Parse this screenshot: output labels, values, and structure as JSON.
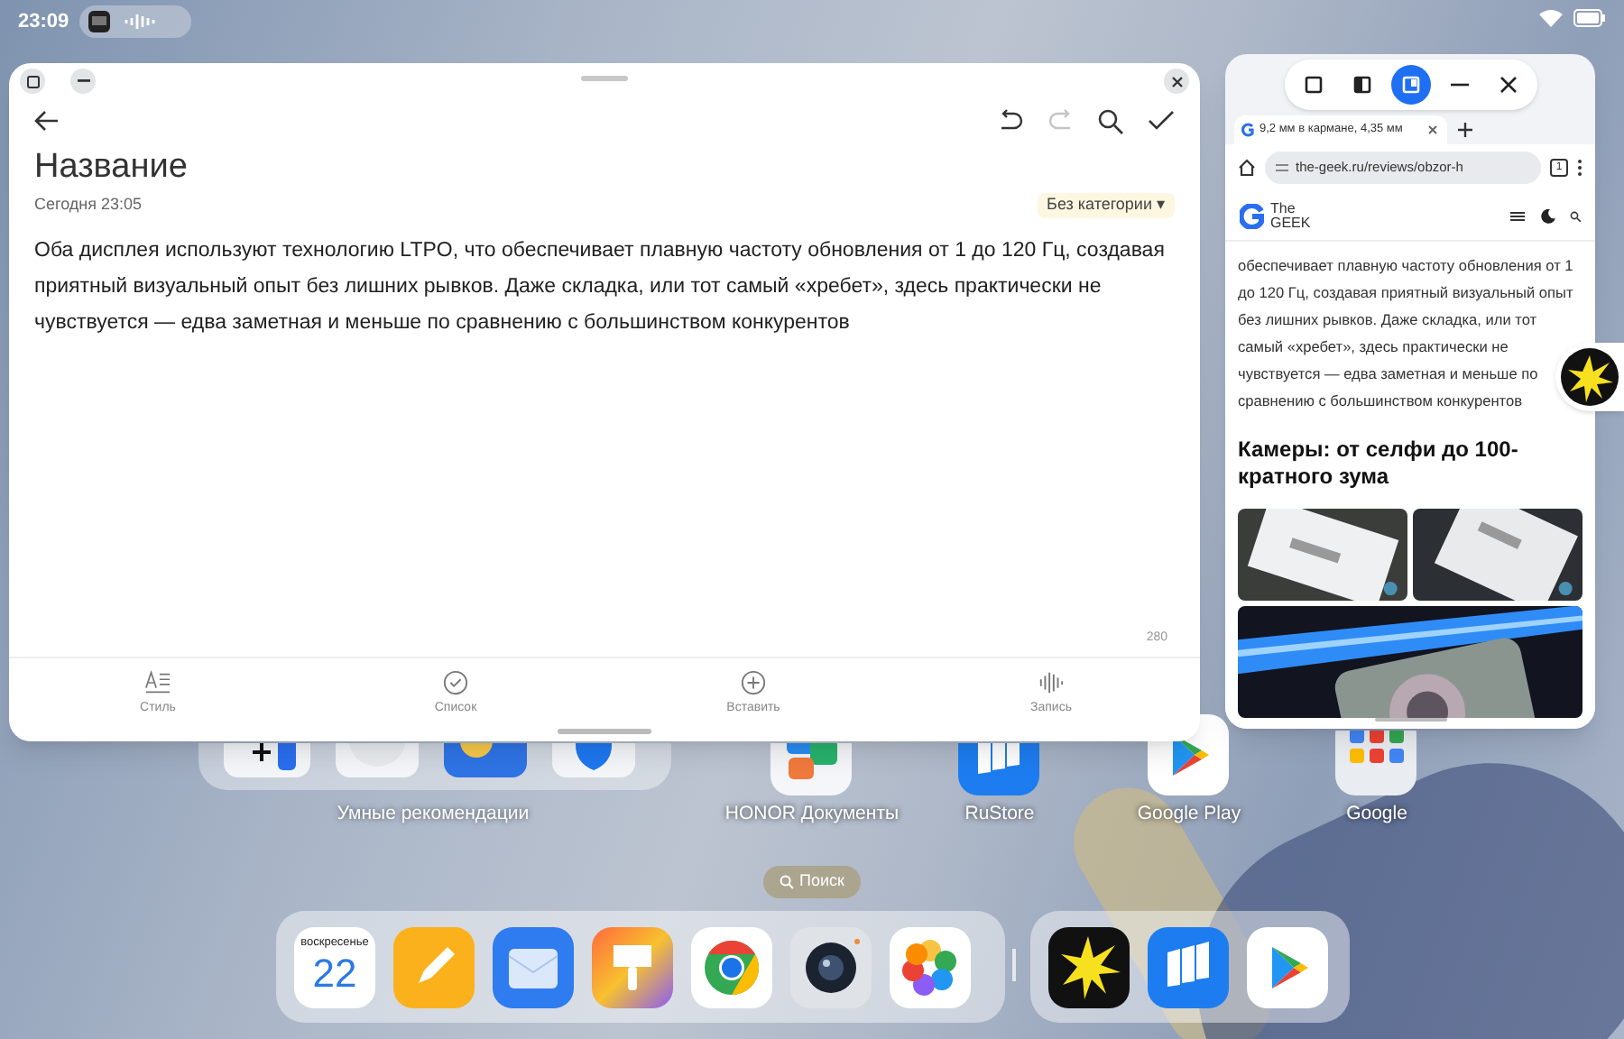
{
  "status_bar": {
    "time": "23:09"
  },
  "note_window": {
    "toolbar": [
      {
        "kind": "undo",
        "disabled": false
      },
      {
        "kind": "redo",
        "disabled": true
      },
      {
        "kind": "search",
        "disabled": false
      },
      {
        "kind": "confirm",
        "disabled": false
      }
    ],
    "title": "Название",
    "date": "Сегодня 23:05",
    "category": "Без категории ▾",
    "body": "Оба дисплея используют технологию LTPO, что обеспечивает плавную частоту обновления от 1 до 120 Гц, создавая приятный визуальный опыт без лишних рывков. Даже складка, или тот самый «хребет», здесь практически не чувствуется — едва заметная и меньше по сравнению с большинством конкурентов",
    "char_count": "280",
    "bottom_tools": [
      {
        "kind": "style",
        "label": "Стиль"
      },
      {
        "kind": "list",
        "label": "Список"
      },
      {
        "kind": "insert",
        "label": "Вставить"
      },
      {
        "kind": "record",
        "label": "Запись"
      }
    ]
  },
  "browser_window": {
    "mode_buttons": [
      {
        "kind": "full",
        "selected": false
      },
      {
        "kind": "split",
        "selected": false
      },
      {
        "kind": "float",
        "selected": true
      },
      {
        "kind": "minimize",
        "selected": false
      },
      {
        "kind": "close",
        "selected": false
      }
    ],
    "tab_title": "9,2 мм в кармане, 4,35 мм",
    "address": "the-geek.ru/reviews/obzor-h",
    "tab_count": "1",
    "site_logo": [
      "The",
      "GEEK"
    ],
    "article_text": "обеспечивает плавную частоту обновления от 1 до 120 Гц, создавая приятный визуальный опыт без лишних рывков. Даже складка, или тот самый «хребет», здесь практически не чувствуется — едва заметная и меньше по сравнению с большинством конкурентов",
    "heading": "Камеры: от селфи до 100-кратного зума",
    "images": [
      {
        "kind": "picture"
      },
      {
        "kind": "picture"
      },
      {
        "kind": "picture"
      }
    ]
  },
  "home": {
    "folder_label": "Умные рекомендации",
    "apps": [
      {
        "kind": "docs",
        "label": "HONOR Документы"
      },
      {
        "kind": "rustore",
        "label": "RuStore"
      },
      {
        "kind": "play",
        "label": "Google Play"
      },
      {
        "kind": "google",
        "label": "Google"
      }
    ]
  },
  "search": {
    "label": "Поиск"
  },
  "dock": {
    "calendar": {
      "weekday": "воскресенье",
      "day": "22"
    },
    "apps": [
      {
        "kind": "notes"
      },
      {
        "kind": "mail"
      },
      {
        "kind": "theme"
      },
      {
        "kind": "chrome"
      },
      {
        "kind": "camera"
      },
      {
        "kind": "gallery"
      }
    ],
    "recent": [
      {
        "kind": "star"
      },
      {
        "kind": "rustore"
      },
      {
        "kind": "play"
      }
    ]
  }
}
